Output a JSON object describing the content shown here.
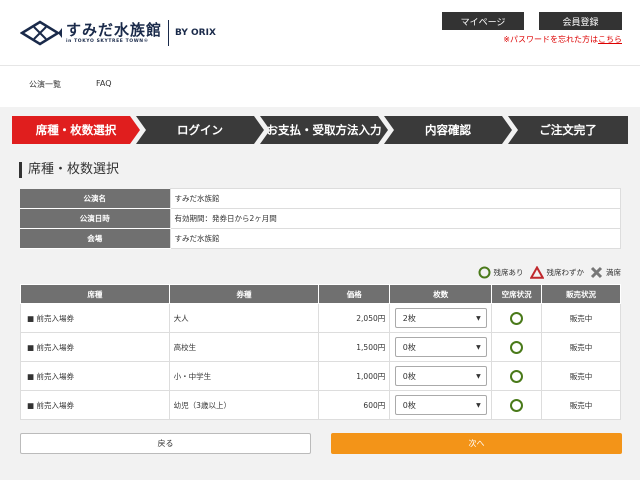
{
  "header": {
    "logo_main": "すみだ水族館",
    "logo_sub": "in TOKYO SKYTREE TOWN®",
    "logo_partner": "BY ORIX",
    "mypage_label": "マイページ",
    "register_label": "会員登録",
    "forgot_prefix": "※パスワードを忘れた方は",
    "forgot_link": "こちら"
  },
  "nav": {
    "items": [
      {
        "label": "公演一覧"
      },
      {
        "label": "FAQ"
      }
    ]
  },
  "steps": [
    {
      "label": "席種・枚数選択",
      "active": true
    },
    {
      "label": "ログイン",
      "active": false
    },
    {
      "label": "お支払・受取方法入力",
      "active": false
    },
    {
      "label": "内容確認",
      "active": false
    },
    {
      "label": "ご注文完了",
      "active": false
    }
  ],
  "section_title": "席種・枚数選択",
  "info": [
    {
      "label": "公演名",
      "value": "すみだ水族館"
    },
    {
      "label": "公演日時",
      "value": "有効期間：発券日から2ヶ月間"
    },
    {
      "label": "会場",
      "value": "すみだ水族館"
    }
  ],
  "legend": {
    "available": "残席あり",
    "few": "残席わずか",
    "full": "満席"
  },
  "table": {
    "headers": [
      "席種",
      "券種",
      "価格",
      "枚数",
      "空席状況",
      "販売状況"
    ],
    "rows": [
      {
        "seat": "前売入場券",
        "kind": "大人",
        "price": "2,050円",
        "qty": "2枚",
        "availability": "available",
        "sale": "販売中"
      },
      {
        "seat": "前売入場券",
        "kind": "高校生",
        "price": "1,500円",
        "qty": "0枚",
        "availability": "available",
        "sale": "販売中"
      },
      {
        "seat": "前売入場券",
        "kind": "小・中学生",
        "price": "1,000円",
        "qty": "0枚",
        "availability": "available",
        "sale": "販売中"
      },
      {
        "seat": "前売入場券",
        "kind": "幼児（3歳以上）",
        "price": "600円",
        "qty": "0枚",
        "availability": "available",
        "sale": "販売中"
      }
    ]
  },
  "buttons": {
    "back": "戻る",
    "next": "次へ"
  },
  "colors": {
    "active_step": "#e01e1e",
    "inactive_step": "#3a3a3a",
    "next_button": "#f39418",
    "available_circle": "#4a7a1a",
    "few_triangle": "#c0282d"
  }
}
